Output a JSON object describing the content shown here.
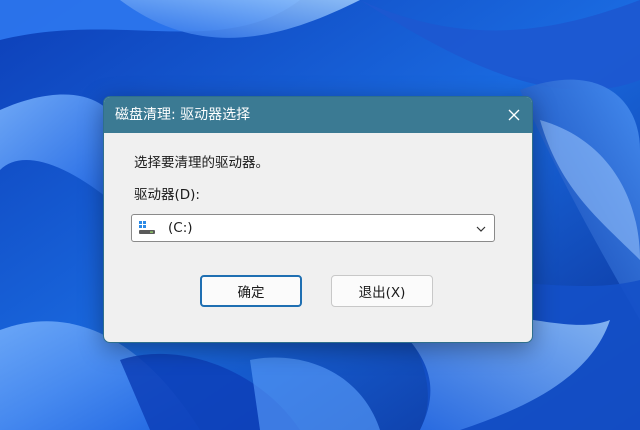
{
  "dialog": {
    "title": "磁盘清理: 驱动器选择",
    "prompt": "选择要清理的驱动器。",
    "drive_label": "驱动器(D):",
    "selected_drive": "(C:)",
    "ok_label": "确定",
    "exit_label": "退出(X)"
  },
  "icons": {
    "close": "close-icon",
    "drive": "drive-icon",
    "dropdown": "chevron-down-icon"
  },
  "colors": {
    "titlebar": "#3b7a93",
    "dialog_bg": "#f0f0f0",
    "ok_border": "#1f6fb2",
    "wallpaper": "#1a5fd6"
  }
}
